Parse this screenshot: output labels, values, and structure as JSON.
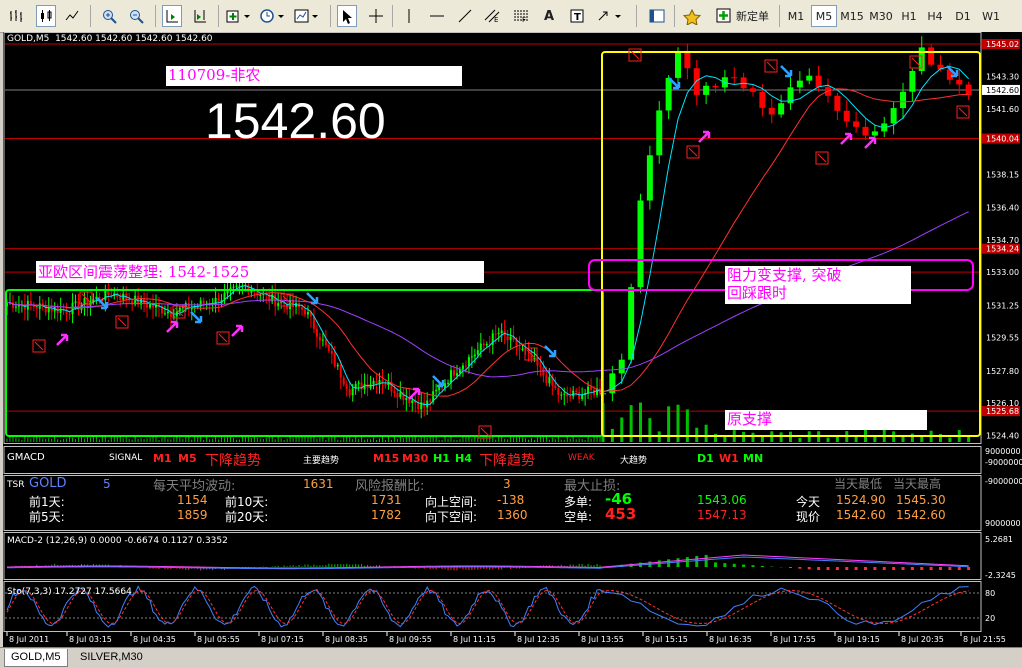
{
  "toolbar": {
    "periods": [
      "M1",
      "M5",
      "M15",
      "M30",
      "H1",
      "H4",
      "D1",
      "W1"
    ],
    "active_period": "M5",
    "new_order_label": "新定单"
  },
  "chart": {
    "header_text": "GOLD,M5  1542.60 1542.60 1542.60 1542.60",
    "big_price": "1542.60",
    "note_nfp": "110709-非农",
    "note_range": "亚欧区间震荡整理: 1542-1525",
    "note_resist": [
      "阻力变支撑, 突破",
      "回踩跟时"
    ],
    "note_support": "原支撑",
    "price_axis": [
      "1545.02",
      "1543.30",
      "1542.60",
      "1541.60",
      "1540.04",
      "1538.15",
      "1536.40",
      "1534.70",
      "1534.24",
      "1533.00",
      "1531.25",
      "1529.55",
      "1527.80",
      "1526.10",
      "1525.68",
      "1524.40"
    ],
    "colors": {
      "bull": "#00ff00",
      "bear": "#ff0000",
      "ma_fast": "#00e5ff",
      "ma_slow": "#ff3030",
      "ma_long": "#a040ff",
      "box_green": "#00ff00",
      "box_yellow": "#ffff00",
      "box_magenta": "#ff00ff"
    }
  },
  "gmacd": {
    "title": "GMACD",
    "signal_label": "SIGNAL",
    "tf_left": [
      "M1",
      "M5"
    ],
    "trend_left": "下降趋势",
    "main_trend": "主要趋势",
    "tf_mid": [
      "M15",
      "M30",
      "H1",
      "H4"
    ],
    "trend_mid": "下降趋势",
    "weak": "WEAK",
    "big_trend": "大趋势",
    "tf_right": [
      "D1",
      "W1",
      "MN"
    ],
    "axis": [
      "9000000",
      "-9000000"
    ]
  },
  "tsr": {
    "label": "TSR",
    "symbol": "GOLD",
    "count": "5",
    "avg_vol_label": "每天平均波动:",
    "avg_vol_value": "1631",
    "risk_label": "风险报酬比:",
    "risk_value": "3",
    "max_sl_label": "最大止损:",
    "rows": [
      {
        "a": "前1天:",
        "b": "1154",
        "c": "前10天:",
        "d": "1731",
        "e": "向上空间:",
        "f": "-138",
        "g": "多单:",
        "h": "-46",
        "i": "1543.06",
        "j": "今天",
        "k": "1524.90",
        "l": "1545.30"
      },
      {
        "a": "前5天:",
        "b": "1859",
        "c": "前20天:",
        "d": "1782",
        "e": "向下空间:",
        "f": "1360",
        "g": "空单:",
        "h": "453",
        "i": "1547.13",
        "j": "现价",
        "k": "1542.60",
        "l": "1542.60"
      }
    ],
    "day_low_label": "当天最低",
    "day_high_label": "当天最高",
    "axis": [
      "-9000000",
      "9000000"
    ]
  },
  "macd": {
    "title": "MACD-2 (12,26,9) 0.0000 -0.6674 0.1127 0.3352",
    "axis": [
      "5.2681",
      "-2.3245"
    ]
  },
  "sto": {
    "title": "Sto(7,3,3) 17.2727 17.5664",
    "axis": [
      "80",
      "20"
    ]
  },
  "time_axis": [
    "8 Jul 2011",
    "8 Jul 03:15",
    "8 Jul 04:35",
    "8 Jul 05:55",
    "8 Jul 07:15",
    "8 Jul 08:35",
    "8 Jul 09:55",
    "8 Jul 11:15",
    "8 Jul 12:35",
    "8 Jul 13:55",
    "8 Jul 15:15",
    "8 Jul 16:35",
    "8 Jul 17:55",
    "8 Jul 19:15",
    "8 Jul 20:35",
    "8 Jul 21:55"
  ],
  "tabs": [
    "GOLD,M5",
    "SILVER,M30"
  ]
}
